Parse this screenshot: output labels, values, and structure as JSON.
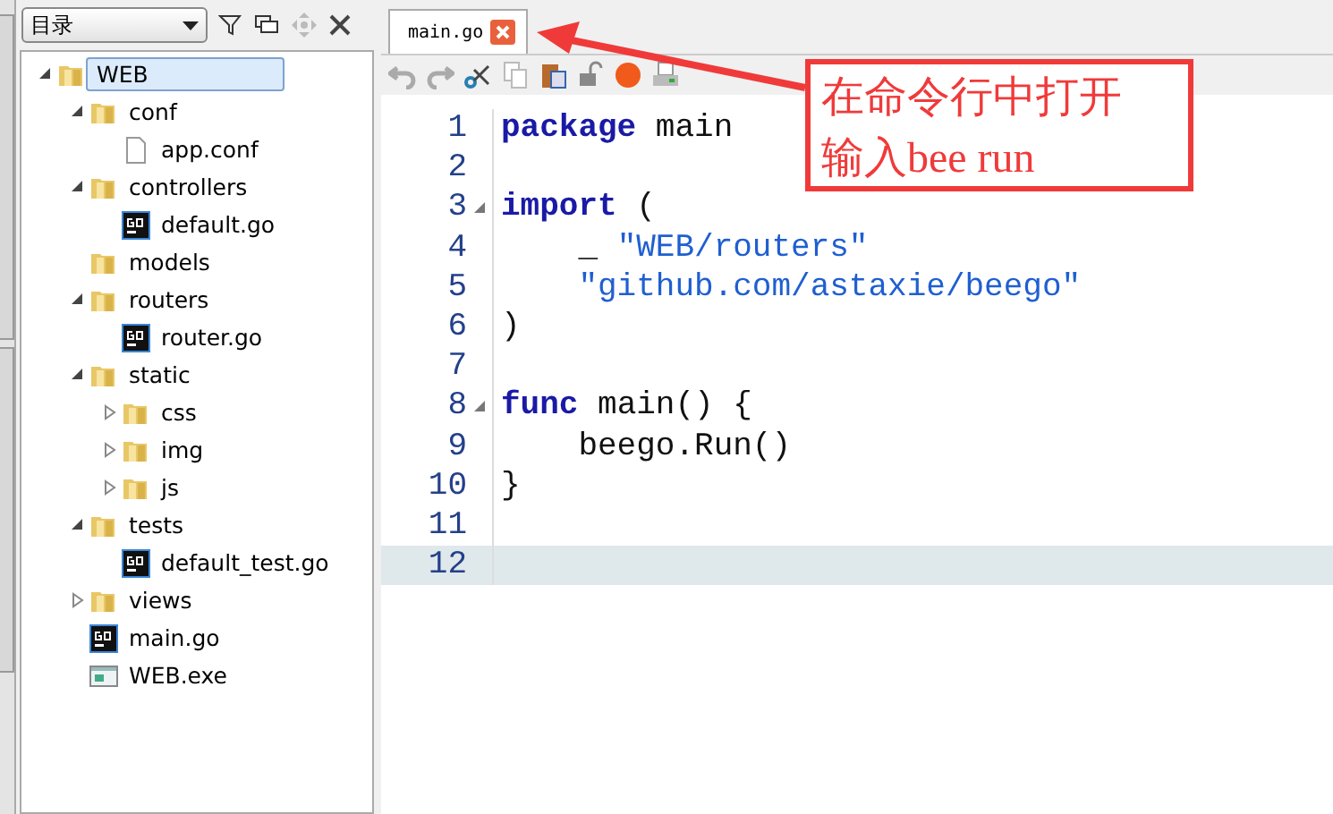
{
  "sidebar": {
    "dropdown": "目录",
    "tree": [
      {
        "label": "WEB",
        "kind": "folder",
        "expanded": true,
        "selected": true,
        "children": [
          {
            "label": "conf",
            "kind": "folder",
            "expanded": true,
            "selected": false,
            "children": [
              {
                "label": "app.conf",
                "kind": "file",
                "selected": false
              }
            ]
          },
          {
            "label": "controllers",
            "kind": "folder",
            "expanded": true,
            "selected": false,
            "children": [
              {
                "label": "default.go",
                "kind": "go",
                "selected": false
              }
            ]
          },
          {
            "label": "models",
            "kind": "folder",
            "selected": false
          },
          {
            "label": "routers",
            "kind": "folder",
            "expanded": true,
            "selected": false,
            "children": [
              {
                "label": "router.go",
                "kind": "go",
                "selected": false
              }
            ]
          },
          {
            "label": "static",
            "kind": "folder",
            "expanded": true,
            "selected": false,
            "children": [
              {
                "label": "css",
                "kind": "folder",
                "expanded": false,
                "selected": false
              },
              {
                "label": "img",
                "kind": "folder",
                "expanded": false,
                "selected": false
              },
              {
                "label": "js",
                "kind": "folder",
                "expanded": false,
                "selected": false
              }
            ]
          },
          {
            "label": "tests",
            "kind": "folder",
            "expanded": true,
            "selected": false,
            "children": [
              {
                "label": "default_test.go",
                "kind": "go",
                "selected": false
              }
            ]
          },
          {
            "label": "views",
            "kind": "folder",
            "expanded": false,
            "selected": false
          },
          {
            "label": "main.go",
            "kind": "go",
            "selected": false
          },
          {
            "label": "WEB.exe",
            "kind": "exe",
            "selected": false
          }
        ]
      }
    ]
  },
  "tabs": [
    {
      "label": "main.go",
      "selected": true
    }
  ],
  "editor": {
    "lines": [
      {
        "number": "1",
        "fold": false,
        "current": false,
        "tokens": [
          {
            "kind": "keyword",
            "text": "package"
          },
          {
            "kind": "plain",
            "text": " main"
          }
        ]
      },
      {
        "number": "2",
        "fold": false,
        "current": false
      },
      {
        "number": "3",
        "fold": true,
        "current": false,
        "tokens": [
          {
            "kind": "keyword",
            "text": "import"
          },
          {
            "kind": "plain",
            "text": " ("
          }
        ]
      },
      {
        "number": "4",
        "fold": false,
        "current": false,
        "tokens": [
          {
            "kind": "plain",
            "text": "    _ "
          },
          {
            "kind": "string",
            "text": "\"WEB/routers\""
          }
        ]
      },
      {
        "number": "5",
        "fold": false,
        "current": false,
        "tokens": [
          {
            "kind": "string",
            "text": "    \"github.com/astaxie/beego\""
          }
        ]
      },
      {
        "number": "6",
        "fold": false,
        "current": false,
        "tokens": [
          {
            "kind": "plain",
            "text": ")"
          }
        ]
      },
      {
        "number": "7",
        "fold": false,
        "current": false
      },
      {
        "number": "8",
        "fold": true,
        "current": false,
        "tokens": [
          {
            "kind": "keyword",
            "text": "func"
          },
          {
            "kind": "plain",
            "text": " main() {"
          }
        ]
      },
      {
        "number": "9",
        "fold": false,
        "current": false,
        "tokens": [
          {
            "kind": "plain",
            "text": "    beego.Run()"
          }
        ]
      },
      {
        "number": "10",
        "fold": false,
        "current": false,
        "tokens": [
          {
            "kind": "plain",
            "text": "}"
          }
        ]
      },
      {
        "number": "11",
        "fold": false,
        "current": false
      },
      {
        "number": "12",
        "fold": false,
        "current": true
      }
    ]
  },
  "annotation": {
    "lines": [
      "在命令行中打开",
      "输入bee run"
    ]
  }
}
